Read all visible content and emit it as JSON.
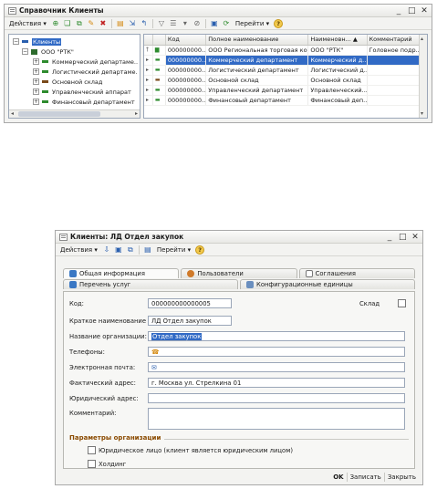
{
  "window1": {
    "title": "Справочник Клиенты",
    "toolbar": {
      "actions": "Действия ▾",
      "goto": "Перейти ▾"
    },
    "tree": {
      "root": "Клиенты",
      "org": "ООО \"РТК\"",
      "items": [
        {
          "label": "Коммерческий департаме...",
          "color": "#2e8b2e"
        },
        {
          "label": "Логистический департаме...",
          "color": "#2e8b2e"
        },
        {
          "label": "Основной склад",
          "color": "#7a4a1a"
        },
        {
          "label": "Управленческий аппарат",
          "color": "#2e8b2e"
        },
        {
          "label": "Финансовый департамент",
          "color": "#2e8b2e"
        }
      ]
    },
    "grid": {
      "columns": [
        "Код",
        "Полное наименование",
        "Наименовн...",
        "Комментарий"
      ],
      "rows": [
        {
          "code": "000000000...",
          "full": "ООО Региональная торговая комп...",
          "name": "ООО \"РТК\"",
          "comment": "Головное подр...",
          "sel": false
        },
        {
          "code": "000000000...",
          "full": "Коммерческий департамент",
          "name": "Коммерческий д...",
          "comment": "",
          "sel": true
        },
        {
          "code": "000000000...",
          "full": "Логистический департамент",
          "name": "Логистический д...",
          "comment": "",
          "sel": false
        },
        {
          "code": "000000000...",
          "full": "Основной склад",
          "name": "Основной склад",
          "comment": "",
          "sel": false
        },
        {
          "code": "000000000...",
          "full": "Управленческий департамент",
          "name": "Управленческий...",
          "comment": "",
          "sel": false
        },
        {
          "code": "000000000...",
          "full": "Финансовый департамент",
          "name": "Финансовый деп...",
          "comment": "",
          "sel": false
        }
      ]
    }
  },
  "window2": {
    "title": "Клиенты: ЛД Отдел закупок",
    "toolbar": {
      "actions": "Действия ▾",
      "goto": "Перейти ▾"
    },
    "tabs_row1": [
      "Общая информация",
      "Пользователи",
      "Соглашения"
    ],
    "tabs_row2": [
      "Перечень услуг",
      "Конфигурационные единицы"
    ],
    "fields": {
      "code_label": "Код:",
      "code_value": "000000000000005",
      "warehouse_label": "Склад",
      "short_name_label": "Краткое наименование",
      "short_name_value": "ЛД Отдел закупок",
      "org_name_label": "Название организации:",
      "org_name_value": "Отдел закупок",
      "phones_label": "Телефоны:",
      "email_label": "Электронная почта:",
      "actual_address_label": "Фактический адрес:",
      "actual_address_value": "г. Москва ул. Стрелкина 01",
      "legal_address_label": "Юридический адрес:",
      "comment_label": "Комментарий:"
    },
    "org_params": {
      "title": "Параметры организации",
      "legal_entity": "Юридическое лицо (клиент является юридическим лицом)",
      "holding": "Холдинг"
    },
    "buttons": {
      "ok": "OK",
      "save": "Записать",
      "close": "Закрыть"
    }
  }
}
